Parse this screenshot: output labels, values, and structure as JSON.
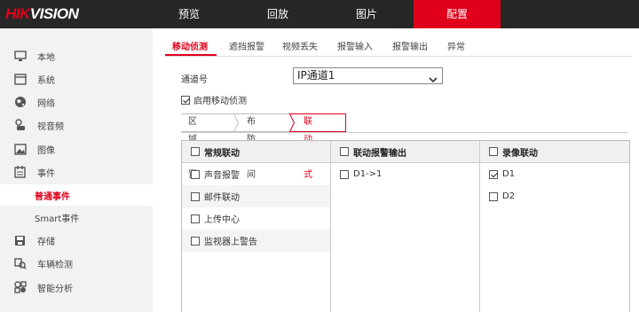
{
  "header": {
    "logo_part1": "HIK",
    "logo_part2": "VISION",
    "nav": [
      {
        "label": "预览",
        "active": false
      },
      {
        "label": "回放",
        "active": false
      },
      {
        "label": "图片",
        "active": false
      },
      {
        "label": "配置",
        "active": true
      }
    ]
  },
  "sidebar": {
    "items": [
      {
        "label": "本地",
        "icon": "monitor-icon"
      },
      {
        "label": "系统",
        "icon": "system-icon"
      },
      {
        "label": "网络",
        "icon": "globe-icon"
      },
      {
        "label": "视音频",
        "icon": "mic-icon"
      },
      {
        "label": "图像",
        "icon": "image-icon"
      },
      {
        "label": "事件",
        "icon": "calendar-icon"
      },
      {
        "label": "普通事件",
        "icon": "",
        "active": true
      },
      {
        "label": "Smart事件",
        "icon": ""
      },
      {
        "label": "存储",
        "icon": "disk-icon"
      },
      {
        "label": "车辆检测",
        "icon": "vehicle-search-icon"
      },
      {
        "label": "智能分析",
        "icon": "analysis-icon"
      }
    ]
  },
  "tabs": [
    {
      "label": "移动侦测",
      "active": true
    },
    {
      "label": "遮挡报警",
      "active": false
    },
    {
      "label": "视频丢失",
      "active": false
    },
    {
      "label": "报警输入",
      "active": false
    },
    {
      "label": "报警输出",
      "active": false
    },
    {
      "label": "异常",
      "active": false
    }
  ],
  "channel": {
    "label": "通道号",
    "value": "IP通道1"
  },
  "enable": {
    "label": "启用移动侦测",
    "checked": true
  },
  "subtabs": [
    {
      "label": "区域设置",
      "active": false
    },
    {
      "label": "布防时间",
      "active": false
    },
    {
      "label": "联动方式",
      "active": true
    }
  ],
  "linkage": {
    "normal": {
      "header": "常规联动",
      "items": [
        "声音报警",
        "邮件联动",
        "上传中心",
        "监视器上警告"
      ]
    },
    "alarm_output": {
      "header": "联动报警输出",
      "items": [
        "D1->1"
      ]
    },
    "record": {
      "header": "录像联动",
      "items": [
        {
          "label": "D1",
          "checked": true
        },
        {
          "label": "D2",
          "checked": false
        }
      ]
    }
  },
  "colors": {
    "accent": "#e0001b",
    "topbar": "#272727",
    "sidebar_bg": "#f2f2f2"
  }
}
